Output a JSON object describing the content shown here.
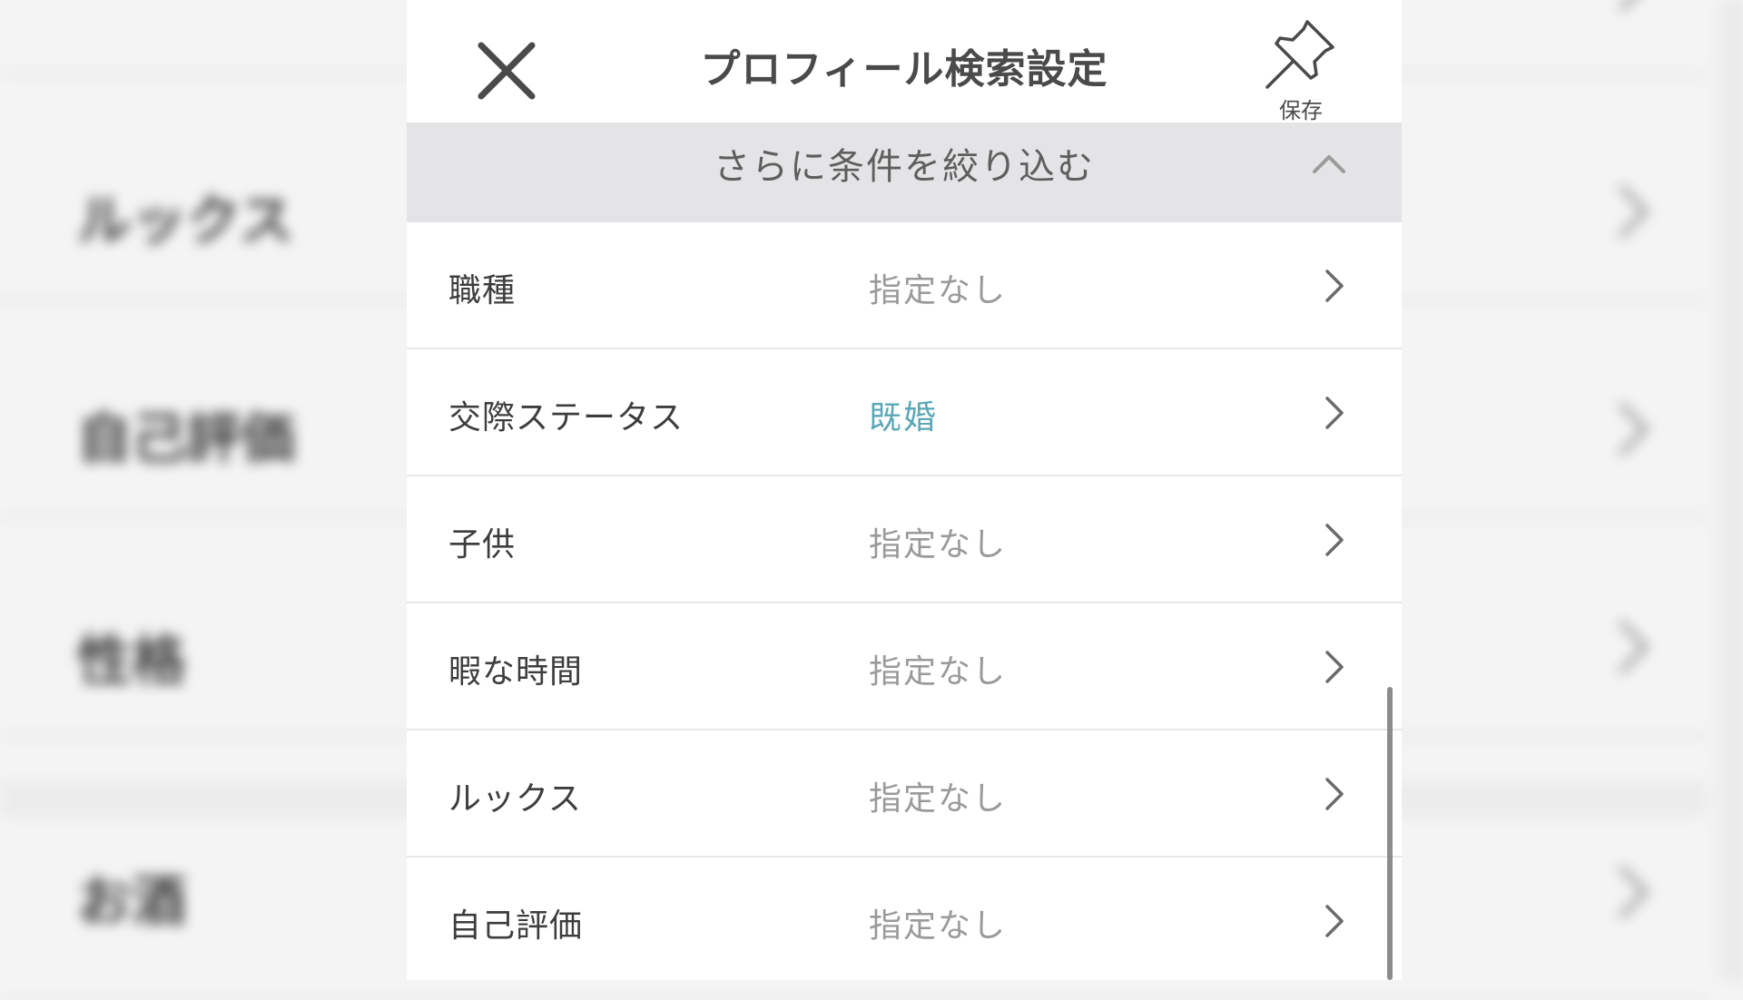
{
  "header": {
    "title": "プロフィール検索設定",
    "save_label": "保存",
    "close_icon": "close-icon",
    "save_icon": "pin-icon"
  },
  "filter_section": {
    "title": "さらに条件を絞り込む",
    "icon": "chevron-up-icon"
  },
  "rows": [
    {
      "label": "職種",
      "value": "指定なし",
      "active": false
    },
    {
      "label": "交際ステータス",
      "value": "既婚",
      "active": true
    },
    {
      "label": "子供",
      "value": "指定なし",
      "active": false
    },
    {
      "label": "暇な時間",
      "value": "指定なし",
      "active": false
    },
    {
      "label": "ルックス",
      "value": "指定なし",
      "active": false
    },
    {
      "label": "自己評価",
      "value": "指定なし",
      "active": false
    }
  ],
  "colors": {
    "active_value": "#5aa7b5",
    "inactive_value": "#9a9a9a",
    "section_bg": "#e4e4e7"
  }
}
